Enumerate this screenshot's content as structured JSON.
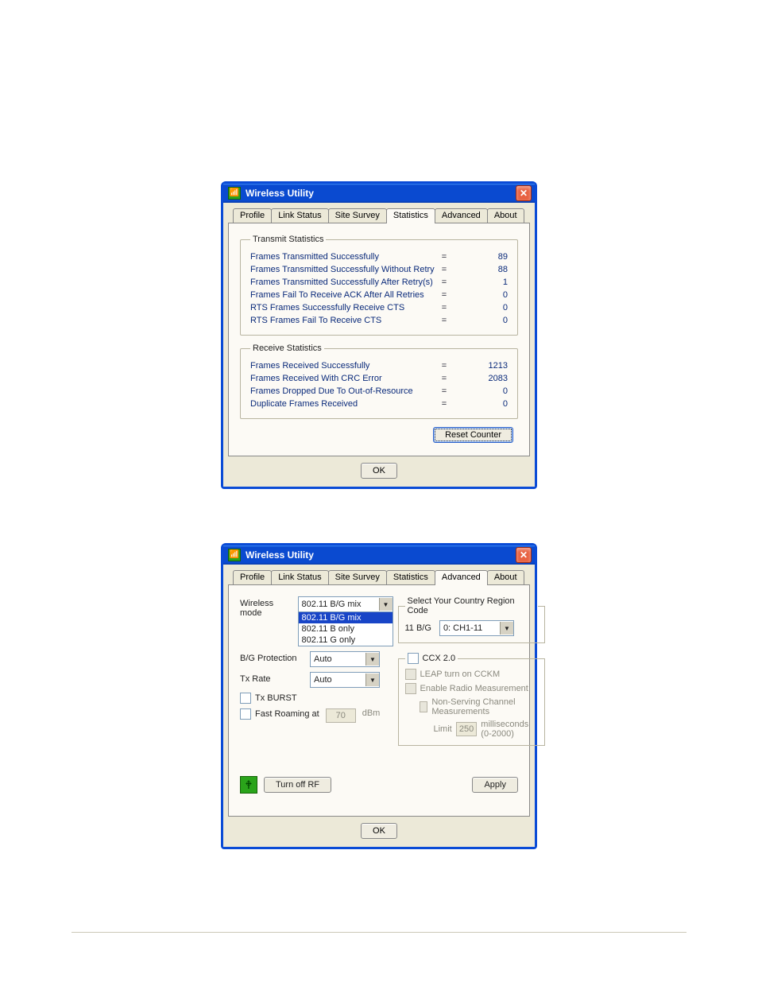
{
  "app": {
    "title": "Wireless Utility"
  },
  "tabs": [
    "Profile",
    "Link Status",
    "Site Survey",
    "Statistics",
    "Advanced",
    "About"
  ],
  "dlg1": {
    "active_tab": 3,
    "tx_group_title": "Transmit Statistics",
    "rx_group_title": "Receive Statistics",
    "tx_rows": [
      {
        "label": "Frames Transmitted Successfully",
        "value": "89"
      },
      {
        "label": "Frames Transmitted Successfully  Without Retry",
        "value": "88"
      },
      {
        "label": "Frames Transmitted Successfully After Retry(s)",
        "value": "1"
      },
      {
        "label": "Frames Fail To Receive ACK After All Retries",
        "value": "0"
      },
      {
        "label": "RTS Frames Successfully Receive CTS",
        "value": "0"
      },
      {
        "label": "RTS Frames Fail To Receive CTS",
        "value": "0"
      }
    ],
    "rx_rows": [
      {
        "label": "Frames Received Successfully",
        "value": "1213"
      },
      {
        "label": "Frames Received With CRC Error",
        "value": "2083"
      },
      {
        "label": "Frames Dropped Due To Out-of-Resource",
        "value": "0"
      },
      {
        "label": "Duplicate Frames Received",
        "value": "0"
      }
    ],
    "reset_label": "Reset Counter",
    "ok_label": "OK"
  },
  "dlg2": {
    "active_tab": 4,
    "wireless_mode_label": "Wireless mode",
    "wireless_mode_value": "802.11 B/G mix",
    "wireless_mode_options": [
      "802.11 B/G mix",
      "802.11 B only",
      "802.11 G only"
    ],
    "bg_protection_label": "B/G Protection",
    "bg_protection_value": "Auto",
    "tx_rate_label": "Tx Rate",
    "tx_rate_value": "Auto",
    "tx_burst_label": "Tx BURST",
    "fast_roaming_label": "Fast Roaming at",
    "fast_roaming_value": "70",
    "fast_roaming_unit": "dBm",
    "region_group_title": "Select Your Country Region Code",
    "region_band": "11 B/G",
    "region_value": "0: CH1-11",
    "ccx_group_title": "CCX 2.0",
    "leap_label": "LEAP turn on CCKM",
    "enable_radio_label": "Enable Radio Measurement",
    "nonserving_label": "Non-Serving Channel Measurements",
    "limit_label": "Limit",
    "limit_value": "250",
    "limit_unit": "milliseconds (0-2000)",
    "turn_off_rf": "Turn off RF",
    "apply_label": "Apply",
    "ok_label": "OK"
  }
}
